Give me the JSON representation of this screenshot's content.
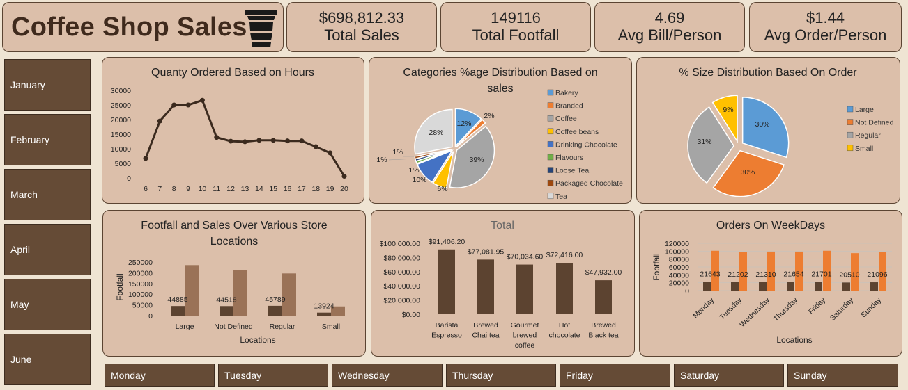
{
  "header": {
    "title": "Coffee Shop Sales",
    "icon": "coffee-cup-icon"
  },
  "kpis": [
    {
      "value": "$698,812.33",
      "label": "Total Sales"
    },
    {
      "value": "149116",
      "label": "Total Footfall"
    },
    {
      "value": "4.69",
      "label": "Avg Bill/Person"
    },
    {
      "value": "$1.44",
      "label": "Avg Order/Person"
    }
  ],
  "months": [
    "January",
    "February",
    "March",
    "April",
    "May",
    "June"
  ],
  "weekdays": [
    "Monday",
    "Tuesday",
    "Wednesday",
    "Thursday",
    "Friday",
    "Saturday",
    "Sunday"
  ],
  "colors": {
    "dark_brown": "#5c4330",
    "light_brown": "#9a7257",
    "orange": "#ed7d31",
    "blue": "#5b9bd5",
    "gray": "#a5a5a5",
    "gold": "#ffc000"
  },
  "chart_data": [
    {
      "type": "line",
      "title": "Quanty Ordered Based on Hours",
      "x": [
        6,
        7,
        8,
        9,
        10,
        11,
        12,
        13,
        14,
        15,
        16,
        17,
        18,
        19,
        20
      ],
      "values": [
        6700,
        19500,
        25000,
        25000,
        26600,
        13900,
        12600,
        12400,
        12900,
        12900,
        12700,
        12700,
        10700,
        8600,
        600
      ],
      "yticks": [
        "0",
        "5000",
        "10000",
        "15000",
        "20000",
        "25000",
        "30000"
      ],
      "ylim": [
        0,
        30000
      ]
    },
    {
      "type": "pie",
      "title": "Categories %age Distribution Based on sales",
      "labels": [
        "Bakery",
        "Branded",
        "Coffee",
        "Coffee beans",
        "Drinking Chocolate",
        "Flavours",
        "Loose Tea",
        "Packaged Chocolate",
        "Tea"
      ],
      "values": [
        12,
        2,
        39,
        6,
        10,
        1,
        1,
        1,
        28
      ],
      "value_labels": [
        "12%",
        "2%",
        "39%",
        "6%",
        "10%",
        "1%",
        "1%",
        "1%",
        "28%"
      ],
      "colors": [
        "#5b9bd5",
        "#ed7d31",
        "#a5a5a5",
        "#ffc000",
        "#4472c4",
        "#70ad47",
        "#264478",
        "#9e480e",
        "#d9d9d9"
      ]
    },
    {
      "type": "pie",
      "title": "% Size Distribution Based On Order",
      "labels": [
        "Large",
        "Not Defined",
        "Regular",
        "Small"
      ],
      "values": [
        30,
        30,
        31,
        9
      ],
      "value_labels": [
        "30%",
        "30%",
        "31%",
        "9%"
      ],
      "colors": [
        "#5b9bd5",
        "#ed7d31",
        "#a5a5a5",
        "#ffc000"
      ]
    },
    {
      "type": "bar",
      "title": "Footfall and Sales Over Various Store Locations",
      "xlabel": "Locations",
      "ylabel": "Footfall",
      "categories": [
        "Large",
        "Not Defined",
        "Regular",
        "Small"
      ],
      "series": [
        {
          "values": [
            44885,
            44518,
            45789,
            13924
          ],
          "labels": [
            "44885",
            "44518",
            "45789",
            "13924"
          ]
        },
        {
          "values": [
            236000,
            212000,
            197000,
            43000
          ]
        }
      ],
      "yticks": [
        "0",
        "50000",
        "100000",
        "150000",
        "200000",
        "250000"
      ],
      "ylim": [
        0,
        250000
      ]
    },
    {
      "type": "bar",
      "title": "Total",
      "categories": [
        "Barista Espresso",
        "Brewed Chai tea",
        "Gourmet brewed coffee",
        "Hot chocolate",
        "Brewed Black tea"
      ],
      "values": [
        91406.2,
        77081.95,
        70034.6,
        72416.0,
        47932.0
      ],
      "value_labels": [
        "$91,406.20",
        "$77,081.95",
        "$70,034.60",
        "$72,416.00",
        "$47,932.00"
      ],
      "yticks": [
        "$0.00",
        "$20,000.00",
        "$40,000.00",
        "$60,000.00",
        "$80,000.00",
        "$100,000.00"
      ],
      "ylim": [
        0,
        100000
      ]
    },
    {
      "type": "bar",
      "title": "Orders On WeekDays",
      "xlabel": "Locations",
      "ylabel": "Footfall",
      "categories": [
        "Monday",
        "Tuesday",
        "Wednesday",
        "Thursday",
        "Friday",
        "Saturday",
        "Sunday"
      ],
      "series": [
        {
          "values": [
            21643,
            21202,
            21310,
            21654,
            21701,
            20510,
            21096
          ],
          "labels": [
            "21643",
            "21202",
            "21310",
            "21654",
            "21701",
            "20510",
            "21096"
          ]
        },
        {
          "values": [
            101000,
            98000,
            99000,
            99000,
            101000,
            95000,
            98000
          ]
        }
      ],
      "yticks": [
        "0",
        "20000",
        "40000",
        "60000",
        "80000",
        "100000",
        "120000"
      ],
      "ylim": [
        0,
        120000
      ]
    }
  ]
}
